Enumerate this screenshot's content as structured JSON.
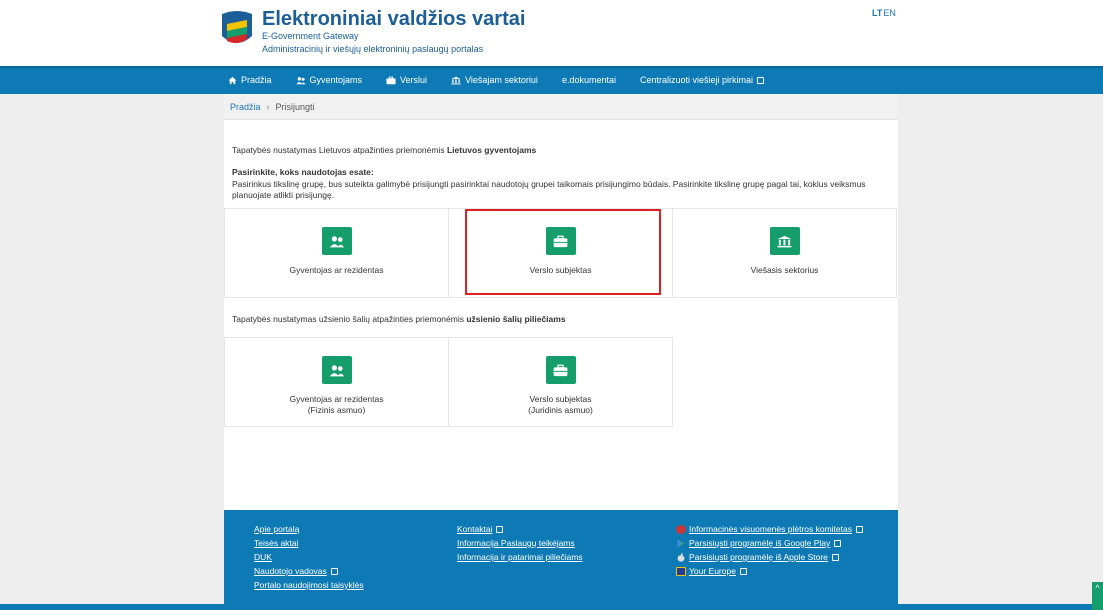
{
  "header": {
    "title": "Elektroniniai valdžios vartai",
    "subtitle1": "E-Government Gateway",
    "subtitle2": "Administracinių ir viešųjų elektroninių paslaugų portalas",
    "lang_lt": "LT",
    "lang_en": "EN"
  },
  "nav": {
    "items": [
      {
        "label": "Pradžia",
        "icon": "home-icon"
      },
      {
        "label": "Gyventojams",
        "icon": "people-icon"
      },
      {
        "label": "Verslui",
        "icon": "briefcase-icon"
      },
      {
        "label": "Viešajam sektoriui",
        "icon": "institution-icon"
      },
      {
        "label": "e.dokumentai",
        "icon": ""
      },
      {
        "label": "Centralizuoti viešieji pirkimai",
        "icon": "external-link-icon"
      }
    ]
  },
  "breadcrumb": {
    "home": "Pradžia",
    "separator": "›",
    "current": "Prisijungti"
  },
  "section1": {
    "intro_prefix": "Tapatybės nustatymas Lietuvos atpažinties priemonėmis ",
    "intro_bold": "Lietuvos gyventojams",
    "choose_heading": "Pasirinkite, koks naudotojas esate:",
    "choose_text": "Pasirinkus tikslinę grupę, bus suteikta galimybė prisijungti pasirinktai naudotojų grupei taikomais prisijungimo būdais. Pasirinkite tikslinę grupę pagal tai, kokius veiksmus planuojate atlikti prisijungę.",
    "tiles": [
      {
        "label": "Gyventojas ar rezidentas",
        "icon": "people-icon"
      },
      {
        "label": "Verslo subjektas",
        "icon": "briefcase-icon"
      },
      {
        "label": "Viešasis sektorius",
        "icon": "institution-icon"
      }
    ]
  },
  "section2": {
    "intro_prefix": "Tapatybės nustatymas užsienio šalių atpažinties priemonėmis ",
    "intro_bold": "užsienio šalių piliečiams",
    "tiles": [
      {
        "label": "Gyventojas ar rezidentas",
        "sublabel": "(Fizinis asmuo)",
        "icon": "people-icon"
      },
      {
        "label": "Verslo subjektas",
        "sublabel": "(Juridinis asmuo)",
        "icon": "briefcase-icon"
      }
    ]
  },
  "footer": {
    "col1": [
      "Apie portalą",
      "Teisės aktai",
      "DUK",
      "Naudotojo vadovas",
      "Portalo naudojimosi taisyklės"
    ],
    "col2": [
      "Kontaktai",
      "Informacija Paslaugų teikėjams",
      "Informacija ir patarimai piliečiams"
    ],
    "col3": [
      "Informacinės visuomenės plėtros komitetas",
      "Parsisiųsti programėlę iš Google Play",
      "Parsisiųsti programėlę iš Apple Store",
      "Your Europe"
    ]
  },
  "colors": {
    "brand_blue": "#0d7ab5",
    "tile_green": "#159e6b",
    "highlight_red": "#e02020"
  }
}
